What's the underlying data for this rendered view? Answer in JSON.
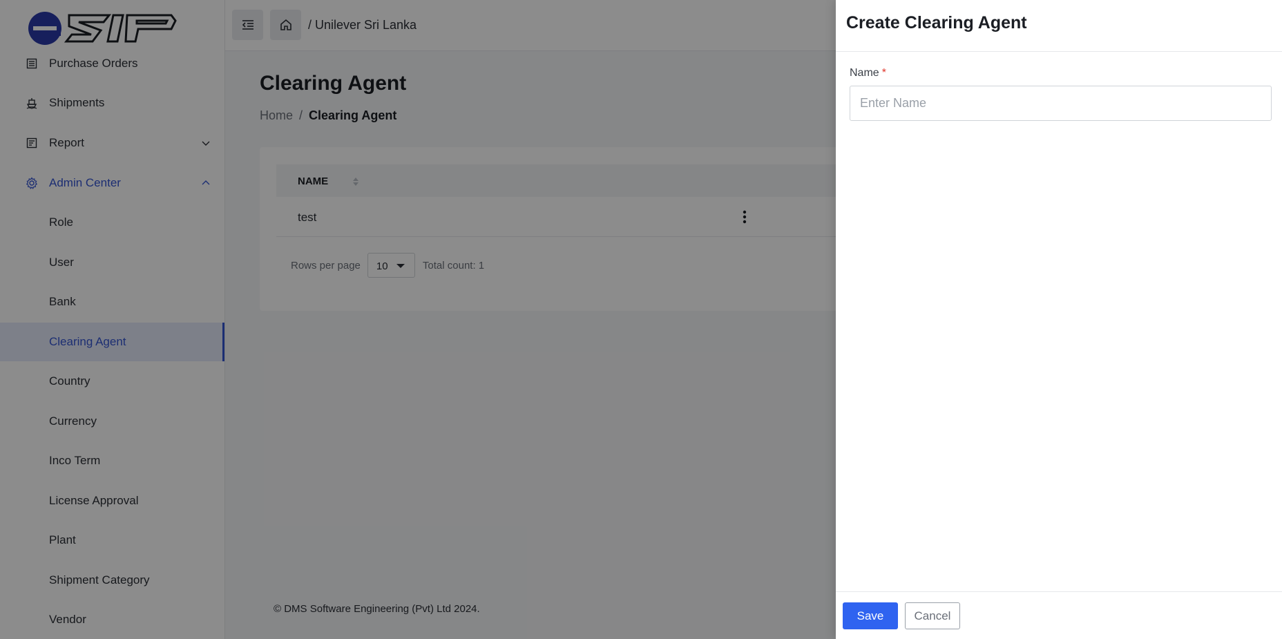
{
  "sidebar": {
    "logo_text": "esip",
    "items": [
      {
        "label": "Purchase Orders",
        "icon": "list-icon"
      },
      {
        "label": "Shipments",
        "icon": "ship-icon"
      },
      {
        "label": "Report",
        "icon": "report-icon"
      },
      {
        "label": "Admin Center",
        "icon": "gear-icon"
      },
      {
        "label": "Role"
      },
      {
        "label": "User"
      },
      {
        "label": "Bank"
      },
      {
        "label": "Clearing Agent"
      },
      {
        "label": "Country"
      },
      {
        "label": "Currency"
      },
      {
        "label": "Inco Term"
      },
      {
        "label": "License Approval"
      },
      {
        "label": "Plant"
      },
      {
        "label": "Shipment Category"
      },
      {
        "label": "Vendor"
      }
    ]
  },
  "topbar": {
    "breadcrumb": "/ Unilever Sri Lanka"
  },
  "main": {
    "title": "Clearing Agent",
    "breadcrumb": {
      "home": "Home",
      "separator": "/",
      "current": "Clearing Agent"
    },
    "table": {
      "columns": [
        "NAME"
      ],
      "rows": [
        {
          "name": "test"
        }
      ]
    },
    "pager": {
      "rows_label": "Rows per page",
      "rows_value": "10",
      "total": "Total count: 1"
    }
  },
  "footer": {
    "text": "© DMS Software Engineering (Pvt) Ltd 2024."
  },
  "drawer": {
    "title": "Create Clearing Agent",
    "name_label": "Name",
    "required_mark": "*",
    "name_placeholder": "Enter Name",
    "name_value": "",
    "save_label": "Save",
    "cancel_label": "Cancel"
  },
  "colors": {
    "accent": "#3454d1",
    "primary_button": "#2f63f0",
    "required": "#e0352b"
  }
}
